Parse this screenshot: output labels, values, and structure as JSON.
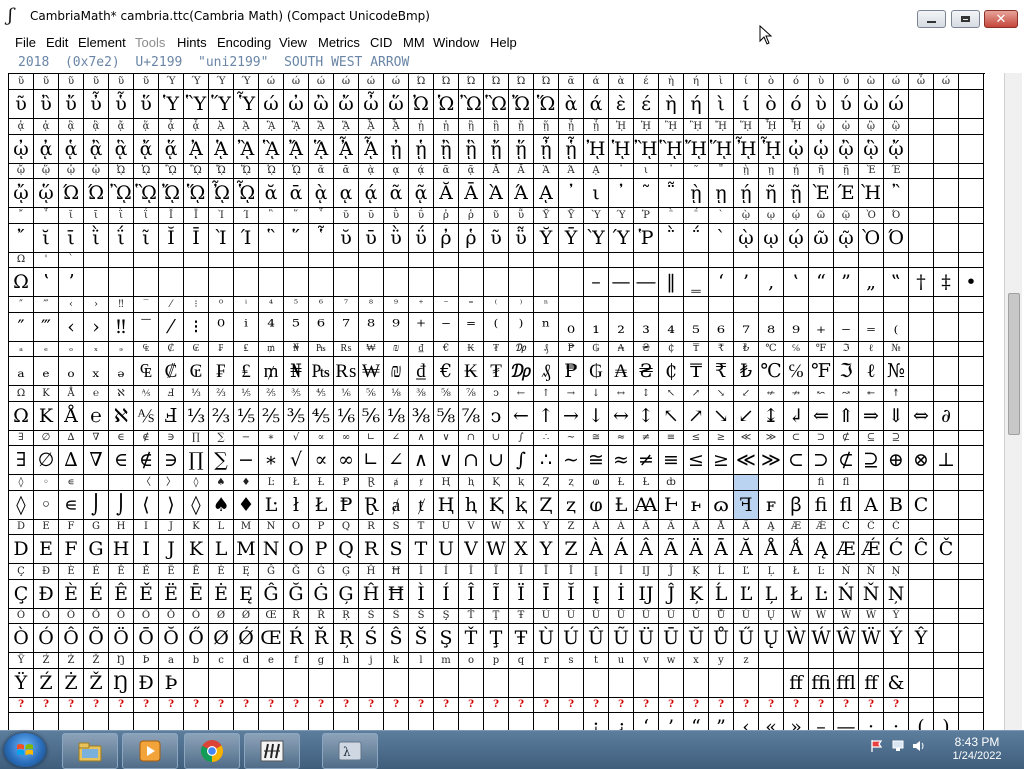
{
  "window": {
    "title": "CambriaMath*  cambria.ttc(Cambria Math) (Compact UnicodeBmp)"
  },
  "menu": [
    "File",
    "Edit",
    "Element",
    "Tools",
    "Hints",
    "Encoding",
    "View",
    "Metrics",
    "CID",
    "MM",
    "Window",
    "Help"
  ],
  "menu_disabled": [
    "Tools"
  ],
  "info": "2018  (0x7e2)  U+2199  \"uni2199\"  SOUTH WEST ARROW",
  "selected": {
    "row": 9,
    "col": 29
  },
  "rows": [
    {
      "labels": [
        "ῦ",
        "ῦ",
        "ῦ",
        "ῦ",
        "ῦ",
        "ῦ",
        "Ύ",
        "Ύ",
        "Ύ",
        "Ύ",
        "ώ",
        "ώ",
        "ώ",
        "ώ",
        "ώ",
        "ώ",
        "Ώ",
        "Ώ",
        "Ώ",
        "Ώ",
        "Ώ",
        "Ώ",
        "ᾶ",
        "ά",
        "ὰ",
        "έ",
        "ὴ",
        "ή",
        "ὶ",
        "ί",
        "ὸ",
        "ό",
        "ὺ",
        "ύ",
        "ὼ",
        "ώ",
        "ὦ",
        "ώ"
      ],
      "glyphs": [
        "ῦ",
        "ὒ",
        "ὔ",
        "ὖ",
        "ὗ",
        "ὕ",
        "Ὑ",
        "Ὓ",
        "Ὕ",
        "Ὗ",
        "ώ",
        "ὠ",
        "ὢ",
        "ὤ",
        "ὦ",
        "ὥ",
        "Ὠ",
        "Ὡ",
        "Ὢ",
        "Ὣ",
        "Ὤ",
        "Ὥ",
        "ὰ",
        "ά",
        "ὲ",
        "έ",
        "ὴ",
        "ή",
        "ὶ",
        "ί",
        "ὸ",
        "ό",
        "ὺ",
        "ύ",
        "ὼ",
        "ώ"
      ]
    },
    {
      "labels": [
        "ᾀ",
        "ᾁ",
        "ᾂ",
        "ᾃ",
        "ᾄ",
        "ᾅ",
        "ᾆ",
        "ᾇ",
        "ᾈ",
        "ᾉ",
        "ᾊ",
        "ᾋ",
        "ᾌ",
        "ᾍ",
        "ᾎ",
        "ᾏ",
        "ᾐ",
        "ᾑ",
        "ᾒ",
        "ᾓ",
        "ᾔ",
        "ᾕ",
        "ᾖ",
        "ᾗ",
        "ᾘ",
        "ᾙ",
        "ᾚ",
        "ᾛ",
        "ᾜ",
        "ᾝ",
        "ᾞ",
        "ᾟ",
        "ᾠ",
        "ᾡ",
        "ᾢ",
        "ᾣ"
      ],
      "glyphs": [
        "ᾠ",
        "ᾀ",
        "ᾁ",
        "ᾂ",
        "ᾃ",
        "ᾄ",
        "ᾅ",
        "ᾈ",
        "ᾉ",
        "ᾊ",
        "ᾋ",
        "ᾌ",
        "ᾍ",
        "ᾎ",
        "ᾏ",
        "ᾐ",
        "ᾑ",
        "ᾒ",
        "ᾓ",
        "ᾔ",
        "ᾕ",
        "ᾖ",
        "ᾗ",
        "ᾘ",
        "ᾙ",
        "ᾚ",
        "ᾛ",
        "ᾜ",
        "ᾝ",
        "ᾞ",
        "ᾟ",
        "ᾠ",
        "ᾡ",
        "ᾢ",
        "ᾣ",
        "ᾤ"
      ]
    },
    {
      "labels": [
        "ᾤ",
        "ᾥ",
        "ᾦ",
        "ᾧ",
        "ᾨ",
        "ᾩ",
        "ᾪ",
        "ᾫ",
        "ᾬ",
        "ᾭ",
        "ᾮ",
        "ᾯ",
        "ᾰ",
        "ᾱ",
        "ᾲ",
        "ᾳ",
        "ᾴ",
        "ᾶ",
        "ᾷ",
        "Ᾰ",
        "Ᾱ",
        "Ὰ",
        "Ά",
        "ᾼ",
        "᾽",
        "ι",
        "᾿",
        "῀",
        "῁",
        "ῂ",
        "ῃ",
        "ῄ",
        "ῆ",
        "ῇ",
        "Ὲ",
        "Έ"
      ],
      "glyphs": [
        "ᾤ",
        "ᾥ",
        "Ώ",
        "Ώ",
        "ᾪ",
        "ᾫ",
        "ᾬ",
        "ᾭ",
        "ᾮ",
        "ᾯ",
        "ᾰ",
        "ᾱ",
        "ᾲ",
        "ᾳ",
        "ᾴ",
        "ᾶ",
        "ᾷ",
        "Ᾰ",
        "Ᾱ",
        "Ὰ",
        "Ά",
        "ᾼ",
        "᾽",
        "ι",
        "᾿",
        "῀",
        "῁",
        "ῂ",
        "ῃ",
        "ῄ",
        "ῆ",
        "ῇ",
        "Ὲ",
        "Έ",
        "Ὴ",
        "῍"
      ]
    },
    {
      "labels": [
        "῎",
        "῏",
        "ῐ",
        "ῑ",
        "ῒ",
        "ΐ",
        "Ῐ",
        "Ῑ",
        "Ὶ",
        "Ί",
        "῝",
        "῞",
        "῟",
        "ῠ",
        "ῡ",
        "ῢ",
        "ΰ",
        "ῤ",
        "ῥ",
        "ῦ",
        "ῧ",
        "Ῠ",
        "Ῡ",
        "Ὺ",
        "Ύ",
        "Ῥ",
        "῭",
        "΅",
        "`",
        "ῲ",
        "ῳ",
        "ῴ",
        "ῶ",
        "ῷ",
        "Ὸ",
        "Ό"
      ],
      "glyphs": [
        "῎",
        "ῐ",
        "ῑ",
        "ῒ",
        "ΐ",
        "ῖ",
        "Ῐ",
        "Ῑ",
        "Ὶ",
        "Ί",
        "῝",
        "῞",
        "῟",
        "ῠ",
        "ῡ",
        "ῢ",
        "ΰ",
        "ῤ",
        "ῥ",
        "ῦ",
        "ῧ",
        "Ῠ",
        "Ῡ",
        "Ὺ",
        "Ύ",
        "Ῥ",
        "῭",
        "΅",
        "`",
        "ῲ",
        "ῳ",
        "ῴ",
        "ῶ",
        "ῷ",
        "Ὸ",
        "Ό"
      ]
    },
    {
      "labels": [
        "Ω",
        "'",
        "`",
        "",
        "",
        "",
        "",
        "",
        "",
        "",
        "",
        "",
        "",
        "",
        "",
        "",
        "",
        "",
        "",
        "",
        "",
        "",
        "",
        "",
        "",
        "",
        "",
        "",
        "",
        "",
        "",
        "",
        "",
        "",
        "",
        "",
        "",
        ""
      ],
      "glyphs": [
        "Ω",
        "ʽ",
        "ʼ",
        " ",
        " ",
        " ",
        " ",
        " ",
        " ",
        " ",
        " ",
        " ",
        " ",
        " ",
        " ",
        " ",
        " ",
        " ",
        " ",
        " ",
        " ",
        " ",
        " ",
        "–",
        "—",
        "―",
        "‖",
        "‗",
        "‘",
        "’",
        "‚",
        "‛",
        "“",
        "”",
        "„",
        "‟",
        "†",
        "‡",
        "•",
        "…",
        "‰"
      ]
    },
    {
      "labels": [
        "″",
        "‴",
        "‹",
        "›",
        "‼",
        "‾",
        "⁄",
        "⁝",
        "⁰",
        "ⁱ",
        "⁴",
        "⁵",
        "⁶",
        "⁷",
        "⁸",
        "⁹",
        "⁺",
        "⁻",
        "⁼",
        "⁽",
        "⁾",
        "ⁿ",
        "",
        "",
        "",
        "",
        "",
        "",
        "",
        "",
        "",
        "",
        "",
        "",
        "",
        ""
      ],
      "glyphs": [
        "″",
        "‴",
        "‹",
        "›",
        "‼",
        "‾",
        "⁄",
        "⁝",
        "⁰",
        "ⁱ",
        "⁴",
        "⁵",
        "⁶",
        "⁷",
        "⁸",
        "⁹",
        "⁺",
        "⁻",
        "⁼",
        "⁽",
        "⁾",
        "ⁿ",
        "₀",
        "₁",
        "₂",
        "₃",
        "₄",
        "₅",
        "₆",
        "₇",
        "₈",
        "₉",
        "₊",
        "₋",
        "₌",
        "₍"
      ]
    },
    {
      "labels": [
        "ₐ",
        "ₑ",
        "ₒ",
        "ₓ",
        "ₔ",
        "₠",
        "₡",
        "₢",
        "₣",
        "₤",
        "₥",
        "₦",
        "₧",
        "₨",
        "₩",
        "₪",
        "₫",
        "€",
        "₭",
        "₮",
        "₯",
        "₰",
        "₱",
        "₲",
        "₳",
        "₴",
        "₵",
        "₸",
        "₹",
        "₺",
        "℃",
        "℅",
        "℉",
        "ℑ",
        "ℓ",
        "№"
      ],
      "glyphs": [
        "ₐ",
        "ₑ",
        "ₒ",
        "ₓ",
        "ₔ",
        "₠",
        "₡",
        "₢",
        "₣",
        "₤",
        "₥",
        "₦",
        "₧",
        "₨",
        "₩",
        "₪",
        "₫",
        "€",
        "₭",
        "₮",
        "₯",
        "₰",
        "₱",
        "₲",
        "₳",
        "₴",
        "₵",
        "₸",
        "₹",
        "₺",
        "℃",
        "℅",
        "℉",
        "ℑ",
        "ℓ",
        "№"
      ]
    },
    {
      "labels": [
        "Ω",
        "K",
        "Å",
        "℮",
        "ℵ",
        "⅍",
        "Ⅎ",
        "⅓",
        "⅔",
        "⅕",
        "⅖",
        "⅗",
        "⅘",
        "⅙",
        "⅚",
        "⅛",
        "⅜",
        "⅝",
        "⅞",
        "ↄ",
        "←",
        "↑",
        "→",
        "↓",
        "↔",
        "↕",
        "↖",
        "↗",
        "↘",
        "↙",
        "↚",
        "↛",
        "↜",
        "↝",
        "↞",
        "↟"
      ],
      "glyphs": [
        "Ω",
        "K",
        "Å",
        "℮",
        "ℵ",
        "⅍",
        "Ⅎ",
        "⅓",
        "⅔",
        "⅕",
        "⅖",
        "⅗",
        "⅘",
        "⅙",
        "⅚",
        "⅛",
        "⅜",
        "⅝",
        "⅞",
        "ↄ",
        "←",
        "↑",
        "→",
        "↓",
        "↔",
        "↕",
        "↖",
        "↗",
        "↘",
        "↙",
        "↨",
        "↲",
        "⇐",
        "⇑",
        "⇒",
        "⇓",
        "⇔",
        "∂"
      ]
    },
    {
      "labels": [
        "∃",
        "∅",
        "∆",
        "∇",
        "∈",
        "∉",
        "∋",
        "∏",
        "∑",
        "−",
        "∗",
        "√",
        "∝",
        "∞",
        "∟",
        "∠",
        "∧",
        "∨",
        "∩",
        "∪",
        "∫",
        "∴",
        "∼",
        "≅",
        "≈",
        "≠",
        "≡",
        "≤",
        "≥",
        "≪",
        "≫",
        "⊂",
        "⊃",
        "⊄",
        "⊆",
        "⊇"
      ],
      "glyphs": [
        "∃",
        "∅",
        "∆",
        "∇",
        "∈",
        "∉",
        "∋",
        "∏",
        "∑",
        "−",
        "∗",
        "√",
        "∝",
        "∞",
        "∟",
        "∠",
        "∧",
        "∨",
        "∩",
        "∪",
        "∫",
        "∴",
        "∼",
        "≅",
        "≈",
        "≠",
        "≡",
        "≤",
        "≥",
        "≪",
        "≫",
        "⊂",
        "⊃",
        "⊄",
        "⊇",
        "⊕",
        "⊗",
        "⊥"
      ]
    },
    {
      "labels": [
        "◊",
        "◦",
        "∊",
        "",
        "",
        "〈",
        "〉",
        "◊",
        "♠",
        "♦",
        "Ŀ",
        "Ł",
        "Ƚ",
        "Ᵽ",
        "Ɽ",
        "ⱥ",
        "ⱦ",
        "Ⱨ",
        "ⱨ",
        "Ⱪ",
        "ⱪ",
        "Ⱬ",
        "ⱬ",
        "ⱷ",
        "Ƚ",
        "Ƚ",
        "ȸ",
        "",
        "",
        "",
        "",
        "",
        "ﬁ",
        "ﬂ",
        "",
        "",
        ""
      ],
      "glyphs": [
        "◊",
        "◦",
        "∊",
        "⌡",
        "⌡",
        "⟨",
        "⟩",
        "◊",
        "♠",
        "♦",
        "Ŀ",
        "ł",
        "Ł",
        "Ᵽ",
        "Ɽ",
        "ⱥ",
        "ⱦ",
        "Ⱨ",
        "ⱨ",
        "Ⱪ",
        "ⱪ",
        "Ⱬ",
        "ⱬ",
        "ⱷ",
        "Ƚ",
        "Ꜳ",
        "Ⱶ",
        "ⱶ",
        "ɷ",
        "ꟻ",
        "ꜰ",
        "ꞵ",
        "ﬁ",
        "ﬂ",
        "A",
        "B",
        "C"
      ]
    },
    {
      "labels": [
        "D",
        "E",
        "F",
        "G",
        "H",
        "I",
        "J",
        "K",
        "L",
        "M",
        "N",
        "O",
        "P",
        "Q",
        "R",
        "S",
        "T",
        "U",
        "V",
        "W",
        "X",
        "Y",
        "Z",
        "À",
        "Á",
        "Â",
        "Ã",
        "Ä",
        "Å",
        "Ä",
        "Ą",
        "Æ",
        "Ǽ",
        "Ć",
        "Ĉ",
        "Ċ"
      ],
      "glyphs": [
        "D",
        "E",
        "F",
        "G",
        "H",
        "I",
        "J",
        "K",
        "L",
        "M",
        "N",
        "O",
        "P",
        "Q",
        "R",
        "S",
        "T",
        "U",
        "V",
        "W",
        "X",
        "Y",
        "Z",
        "À",
        "Á",
        "Â",
        "Ã",
        "Ä",
        "Ā",
        "Ă",
        "Å",
        "Ǻ",
        "Ą",
        "Æ",
        "Ǽ",
        "Ć",
        "Ĉ",
        "Č"
      ]
    },
    {
      "labels": [
        "Ç",
        "Ð",
        "È",
        "É",
        "Ê",
        "Ě",
        "Ë",
        "Ē",
        "Ė",
        "Ę",
        "Ĝ",
        "Ğ",
        "Ġ",
        "Ģ",
        "Ĥ",
        "Ħ",
        "Ì",
        "Í",
        "Î",
        "Ĩ",
        "Ï",
        "Ī",
        "Ĭ",
        "Į",
        "İ",
        "Ĳ",
        "Ĵ",
        "Ķ",
        "Ĺ",
        "Ľ",
        "Ļ",
        "Ł",
        "Ŀ",
        "Ń",
        "Ň",
        "Ņ"
      ],
      "glyphs": [
        "Ç",
        "Đ",
        "È",
        "É",
        "Ê",
        "Ě",
        "Ë",
        "Ē",
        "Ė",
        "Ę",
        "Ĝ",
        "Ğ",
        "Ġ",
        "Ģ",
        "Ĥ",
        "Ħ",
        "Ì",
        "Í",
        "Î",
        "Ĩ",
        "Ï",
        "Ī",
        "Ĭ",
        "Į",
        "İ",
        "Ĳ",
        "Ĵ",
        "Ķ",
        "Ĺ",
        "Ľ",
        "Ļ",
        "Ł",
        "Ŀ",
        "Ń",
        "Ň",
        "Ņ"
      ]
    },
    {
      "labels": [
        "Ò",
        "Ó",
        "Ô",
        "Õ",
        "Ö",
        "Ō",
        "Ŏ",
        "Ő",
        "Ø",
        "Ǿ",
        "Œ",
        "Ŕ",
        "Ř",
        "Ŗ",
        "Ś",
        "Ŝ",
        "Š",
        "Ş",
        "Ť",
        "Ţ",
        "Ŧ",
        "Ù",
        "Ú",
        "Û",
        "Ũ",
        "Ü",
        "Ū",
        "Ŭ",
        "Ů",
        "Ű",
        "Ų",
        "Ẁ",
        "Ẃ",
        "Ŵ",
        "Ẅ",
        "Ỳ"
      ],
      "glyphs": [
        "Ò",
        "Ó",
        "Ô",
        "Õ",
        "Ö",
        "Ō",
        "Ŏ",
        "Ő",
        "Ø",
        "Ǿ",
        "Œ",
        "Ŕ",
        "Ř",
        "Ŗ",
        "Ś",
        "Ŝ",
        "Š",
        "Ş",
        "Ť",
        "Ţ",
        "Ŧ",
        "Ù",
        "Ú",
        "Û",
        "Ũ",
        "Ü",
        "Ū",
        "Ŭ",
        "Ů",
        "Ű",
        "Ų",
        "Ẁ",
        "Ẃ",
        "Ŵ",
        "Ẅ",
        "Ý",
        "Ŷ"
      ]
    },
    {
      "labels": [
        "Ÿ",
        "Ź",
        "Ż",
        "Ž",
        "Ŋ",
        "Þ",
        "a",
        "b",
        "c",
        "d",
        "e",
        "f",
        "g",
        "h",
        "j",
        "k",
        "l",
        "m",
        "o",
        "p",
        "q",
        "r",
        "s",
        "t",
        "u",
        "v",
        "w",
        "x",
        "y",
        "z",
        "",
        "",
        "",
        "",
        "",
        "",
        ""
      ],
      "glyphs": [
        "Ÿ",
        "Ź",
        "Ż",
        "Ž",
        "Ŋ",
        "Đ",
        "Þ",
        " ",
        " ",
        " ",
        " ",
        " ",
        " ",
        " ",
        " ",
        " ",
        " ",
        " ",
        " ",
        " ",
        " ",
        " ",
        " ",
        " ",
        " ",
        " ",
        " ",
        " ",
        " ",
        " ",
        " ",
        "ﬀ",
        "ﬃ",
        "ﬄ",
        "ﬀ",
        "&"
      ]
    },
    {
      "labels": [
        "?",
        "?",
        "?",
        "?",
        "?",
        "?",
        "?",
        "?",
        "?",
        "?",
        "?",
        "?",
        "?",
        "?",
        "?",
        "?",
        "?",
        "?",
        "?",
        "?",
        "?",
        "?",
        "?",
        "?",
        "?",
        "?",
        "?",
        "?",
        "?",
        "?",
        "?",
        "?",
        "?",
        "?",
        "?",
        "?"
      ],
      "glyphs": [
        " ",
        " ",
        " ",
        " ",
        " ",
        " ",
        " ",
        " ",
        " ",
        " ",
        " ",
        " ",
        " ",
        " ",
        " ",
        " ",
        " ",
        " ",
        " ",
        " ",
        " ",
        " ",
        " ",
        "¡",
        "¿",
        "‘",
        "’",
        "“",
        "”",
        "‹",
        "«",
        "»",
        "–",
        "—",
        "·",
        "·",
        "(",
        ")"
      ]
    }
  ],
  "taskbar": {
    "buttons": [
      "explorer-icon",
      "media-player-icon",
      "chrome-icon",
      "fontforge-icon",
      "terminal-icon"
    ],
    "time": "8:43 PM",
    "date": "1/24/2022"
  }
}
